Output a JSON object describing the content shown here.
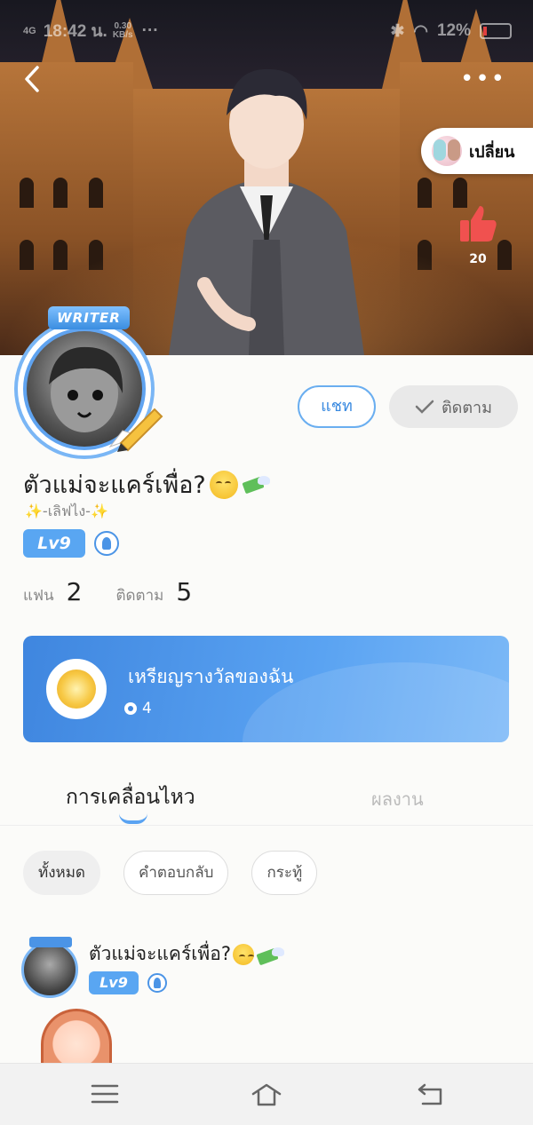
{
  "status_bar": {
    "signal": "4G",
    "time": "18:42 น.",
    "speed_value": "0.30",
    "speed_unit": "KB/s",
    "dots": "···",
    "battery": "12%"
  },
  "header": {
    "switch_label": "เปลี่ยน",
    "like_count": "20"
  },
  "profile": {
    "writer_tag": "WRITER",
    "chat_button": "แชท",
    "follow_button": "ติดตาม",
    "name": "ตัวแม่จะแคร์เพื่อ?",
    "bio": "-เลิฟไง-",
    "level": "Lv9",
    "stats": {
      "fans_label": "แฟน",
      "fans_value": "2",
      "following_label": "ติดตาม",
      "following_value": "5"
    }
  },
  "medal": {
    "title": "เหรียญรางวัลของฉัน",
    "count": "4"
  },
  "tabs": [
    {
      "label": "การเคลื่อนไหว",
      "active": true
    },
    {
      "label": "ผลงาน",
      "active": false
    }
  ],
  "filters": [
    {
      "label": "ทั้งหมด",
      "active": true
    },
    {
      "label": "คำตอบกลับ",
      "active": false
    },
    {
      "label": "กระทู้",
      "active": false
    }
  ],
  "post": {
    "author": "ตัวแม่จะแคร์เพื่อ?",
    "level": "Lv9"
  },
  "icons": {
    "back": "back-arrow-icon",
    "more": "more-dots-icon",
    "like": "thumbs-up-icon",
    "follow_check": "check-icon",
    "nav_menu": "menu-icon",
    "nav_home": "home-icon",
    "nav_back": "return-icon"
  },
  "colors": {
    "accent": "#5aa3f2",
    "medal_card": "#3f86df",
    "like": "#f0514f"
  }
}
